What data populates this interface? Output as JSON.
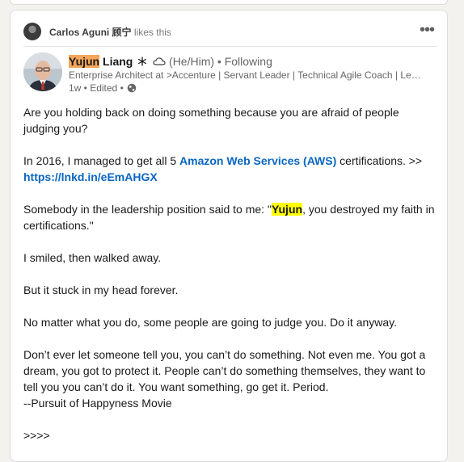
{
  "social": {
    "name": "Carlos Aguni 顾宁",
    "action": "likes this"
  },
  "author": {
    "first": "Yujun",
    "last": " Liang",
    "pronouns": "(He/Him)",
    "following": "• Following",
    "headline": "Enterprise Architect at >Accenture | Servant Leader | Technical Agile Coach | Lead...",
    "time": "1w • Edited •"
  },
  "post": {
    "p1": "Are you holding back on doing something because you are afraid of people judging you?",
    "p2a": "In 2016, I managed to get all 5 ",
    "p2link": "Amazon Web Services (AWS)",
    "p2b": " certifications. >> ",
    "p2url": "https://lnkd.in/eEmAHGX",
    "p3a": "Somebody in the leadership position said to me: \"",
    "p3mention": "Yujun",
    "p3b": ", you destroyed my faith in certifications.\"",
    "p4": "I smiled, then walked away.",
    "p5": "But it stuck in my head forever.",
    "p6": "No matter what you do, some people are going to judge you. Do it anyway.",
    "p7a": "Don’t ever let someone tell you, you can’t do something. Not even me. You got a dream, you got to protect it. People can’t do something themselves, they want to tell you you can’t do it. You want something, go get it. Period.",
    "p7b": "--Pursuit of Happyness Movie",
    "p8": ">>>>"
  },
  "icons": {
    "more": "more-options-icon",
    "snowflake": "snowflake-icon",
    "cloud": "cloud-icon",
    "globe": "globe-icon"
  }
}
